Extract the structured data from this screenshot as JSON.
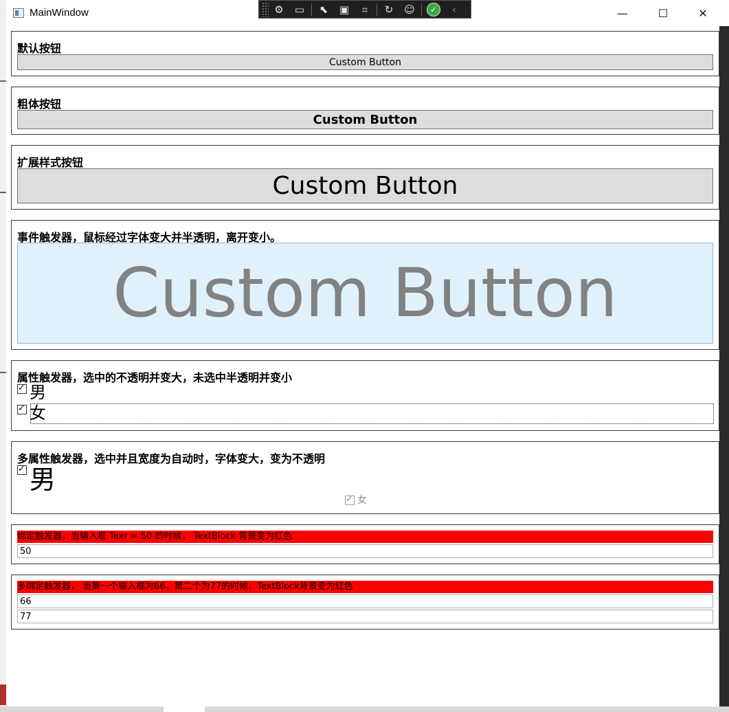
{
  "window": {
    "title": "MainWindow",
    "minimize_glyph": "—",
    "maximize_glyph": "☐",
    "close_glyph": "✕"
  },
  "debug_toolbar": {
    "icons": [
      "select-element-icon",
      "video-icon",
      "pointer-select-icon",
      "frame-icon",
      "tracker-icon",
      "hot-reload-icon",
      "accessibility-icon",
      "check-ok-icon",
      "collapse-icon"
    ]
  },
  "sections": {
    "default_button": {
      "title": "默认按钮",
      "button_label": "Custom Button"
    },
    "bold_button": {
      "title": "粗体按钮",
      "button_label": "Custom Button"
    },
    "extended_style_button": {
      "title": "扩展样式按钮",
      "button_label": "Custom Button"
    },
    "event_trigger": {
      "title": "事件触发器，鼠标经过字体变大并半透明，离开变小。",
      "button_label": "Custom Button"
    },
    "property_trigger": {
      "title": "属性触发器，选中的不透明并变大，未选中半透明并变小",
      "options": [
        "男",
        "女"
      ]
    },
    "multi_property_trigger": {
      "title": "多属性触发器，选中并且宽度为自动时，字体变大，变为不透明",
      "options": [
        "男",
        "女"
      ]
    },
    "data_trigger": {
      "text": "绑定触发器，当输入框 Texr = 50 的时候， TextBlock 背景变为红色",
      "input_value": "50"
    },
    "multi_data_trigger": {
      "text": "多绑定触发器， 当第一个输入框为66，第二个为77的时候，TextBlock背景变为红色",
      "input1_value": "66",
      "input2_value": "77"
    }
  },
  "colors": {
    "button_bg": "#dddddd",
    "hover_button_bg": "#e0f1fc",
    "red_highlight": "#ff0000"
  }
}
